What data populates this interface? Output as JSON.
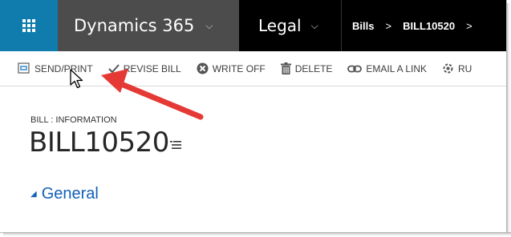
{
  "nav": {
    "app_title": "Dynamics 365",
    "area": "Legal",
    "breadcrumb": [
      "Bills",
      "BILL10520"
    ],
    "waffle_icon": "waffle-grid-icon",
    "colors": {
      "waffle_bg": "#0f7cad",
      "app_tile_bg": "#4c4c4c",
      "bar_bg": "#000000"
    }
  },
  "commands": [
    {
      "label": "SEND/PRINT",
      "icon": "send-print-icon"
    },
    {
      "label": "REVISE BILL",
      "icon": "checkmark-icon"
    },
    {
      "label": "WRITE OFF",
      "icon": "cancel-circle-icon"
    },
    {
      "label": "DELETE",
      "icon": "trash-icon"
    },
    {
      "label": "EMAIL A LINK",
      "icon": "link-icon"
    },
    {
      "label": "RU",
      "icon": "workflow-icon"
    }
  ],
  "form": {
    "entity_label": "BILL : INFORMATION",
    "record_title": "BILL10520",
    "section_label": "General",
    "section_color": "#1160b7"
  },
  "annotation": {
    "arrow_color": "#e53935"
  }
}
